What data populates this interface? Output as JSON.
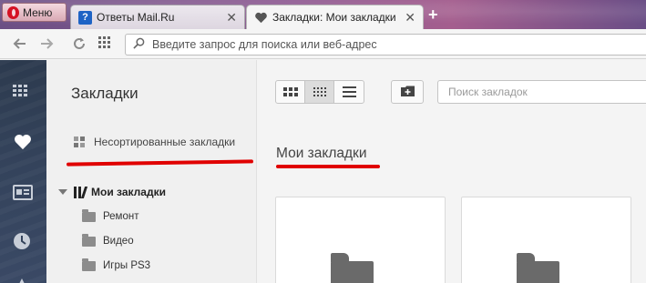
{
  "browser": {
    "menu_label": "Меню",
    "tabs": [
      {
        "title": "Ответы Mail.Ru",
        "favicon": "mailru-answers-icon",
        "active": false
      },
      {
        "title": "Закладки: Мои закладки",
        "favicon": "heart-icon",
        "active": true
      }
    ],
    "new_tab_label": "+",
    "close_label": "✕",
    "address_placeholder": "Введите запрос для поиска или веб-адрес"
  },
  "sidebar_icons": [
    "speed-dial-icon",
    "heart-icon",
    "news-icon",
    "history-icon"
  ],
  "bookmarks_nav": {
    "heading": "Закладки",
    "unsorted_label": "Несортированные закладки",
    "tree_root": "Мои закладки",
    "folders": [
      "Ремонт",
      "Видео",
      "Игры PS3"
    ]
  },
  "main": {
    "search_placeholder": "Поиск закладок",
    "title": "Мои закладки"
  },
  "colors": {
    "annotation_red": "#e00000",
    "opera_red": "#d51224"
  }
}
